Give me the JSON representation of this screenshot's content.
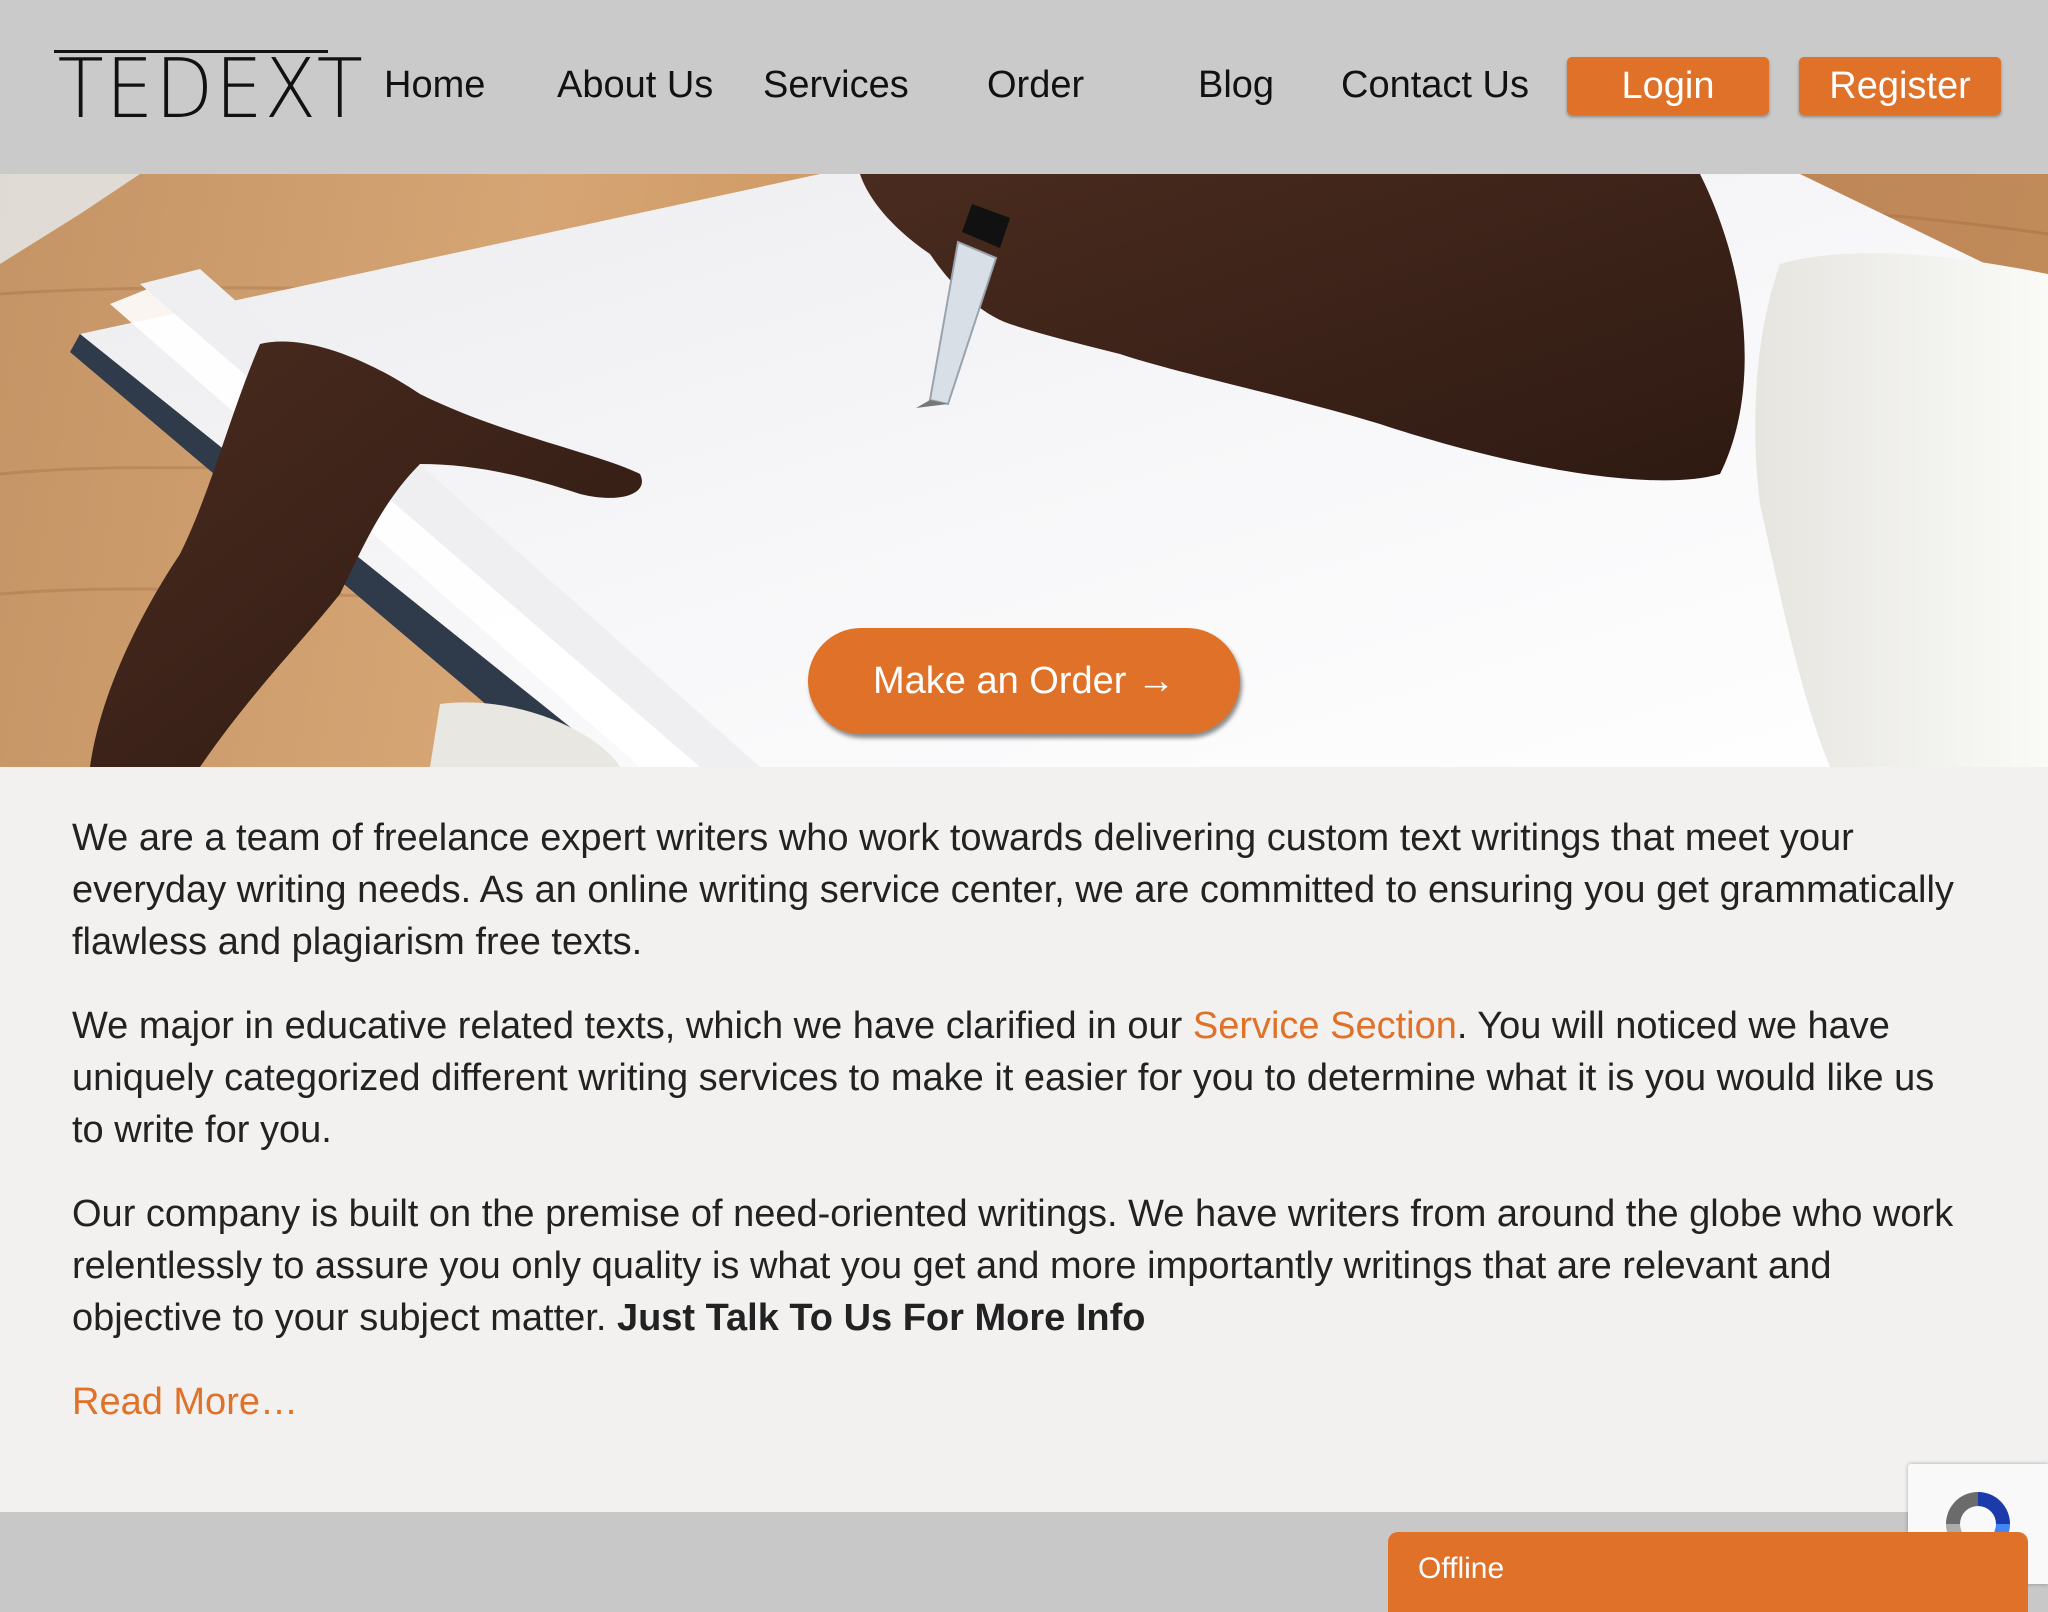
{
  "header": {
    "logo_text": "TEDEXT",
    "nav": [
      "Home",
      "About Us",
      "Services",
      "Order",
      "Blog",
      "Contact Us"
    ],
    "login_label": "Login",
    "register_label": "Register"
  },
  "hero": {
    "cta_label": "Make an Order →"
  },
  "content": {
    "p1": "We are a team of freelance expert writers who work towards delivering custom text writings that meet your everyday writing needs. As an online writing service center, we are committed to ensuring you get grammatically flawless and plagiarism free texts.",
    "p2_before": "We major in educative related texts, which we have clarified in our ",
    "p2_link": "Service Section",
    "p2_after": ". You will noticed we have uniquely categorized different writing services to make it easier for you to determine what it is you would like us to write for you.",
    "p3": "Our company is built on the premise of need-oriented writings. We have writers from around the globe who work relentlessly to assure you only quality is what you get and more importantly writings that are relevant and objective to your subject matter. ",
    "p3_bold": "Just Talk To Us For More Info",
    "read_more": "Read More…"
  },
  "chat": {
    "status": "Offline"
  },
  "colors": {
    "accent": "#e07128",
    "header_bg": "#cacaca",
    "page_bg": "#f2f1f0"
  }
}
